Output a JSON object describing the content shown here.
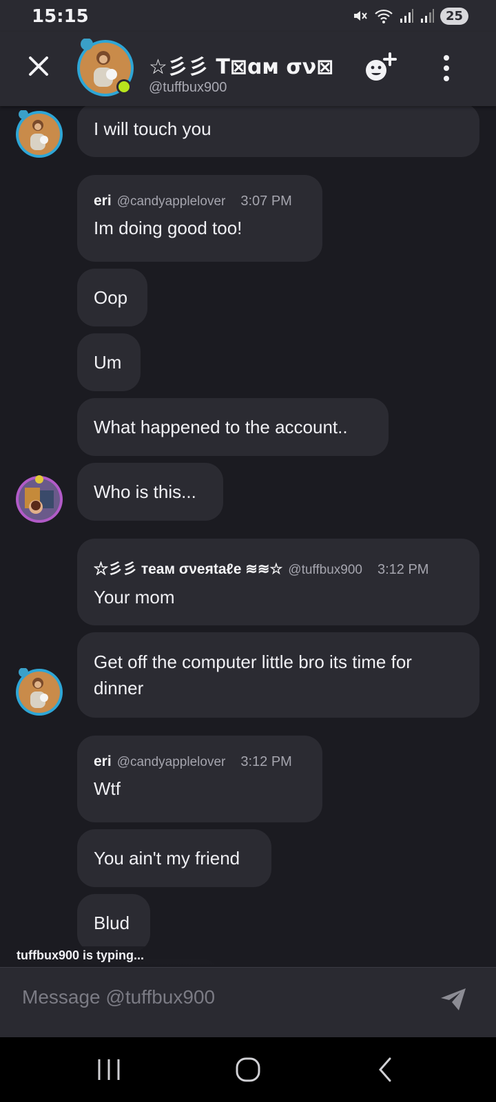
{
  "status": {
    "time": "15:15",
    "battery": "25"
  },
  "header": {
    "title": "☆彡彡 Т⊠ɑм σν⊠",
    "handle": "@tuffbux900"
  },
  "messages": [
    {
      "text": "I will touch you"
    },
    {
      "author": "eri",
      "handle": "@candyapplelover",
      "time": "3:07 PM",
      "text": "Im doing good too!"
    },
    {
      "text": "Oop"
    },
    {
      "text": "Um"
    },
    {
      "text": "What happened to the account.."
    },
    {
      "text": "Who is this..."
    },
    {
      "author": "☆彡彡 тeaм σνeяtaℓe ≋≋☆",
      "handle": "@tuffbux900",
      "time": "3:12 PM",
      "text": "Your mom"
    },
    {
      "text": "Get off the computer little bro its time for dinner"
    },
    {
      "author": "eri",
      "handle": "@candyapplelover",
      "time": "3:12 PM",
      "text": "Wtf"
    },
    {
      "text": "You ain't my friend"
    },
    {
      "text": "Blud"
    }
  ],
  "typing": "tuffbux900 is typing...",
  "composer": {
    "placeholder": "Message @tuffbux900"
  },
  "icons": {
    "close": "close-icon",
    "add_friend": "add-friend-icon",
    "more": "more-vertical-icon",
    "send": "send-icon",
    "nav_recents": "recents-icon",
    "nav_home": "home-icon",
    "nav_back": "back-icon"
  },
  "colors": {
    "background": "#1b1b21",
    "bubble": "#2b2b32",
    "header": "#2a2a31",
    "online": "#b7e51d"
  }
}
